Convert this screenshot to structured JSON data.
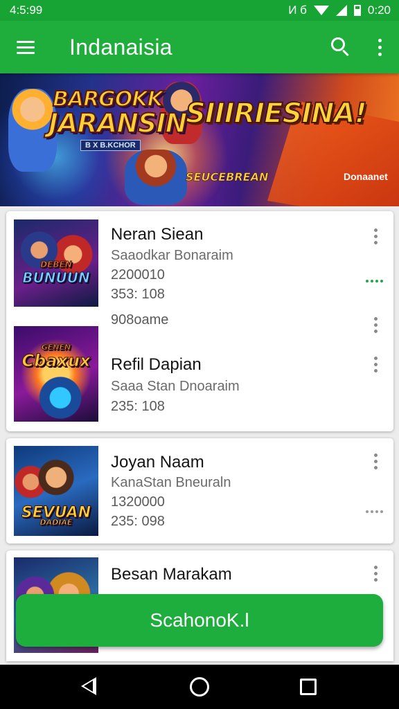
{
  "status_bar": {
    "time": "4:5:99",
    "status_icons": "И б",
    "clock": "0:20"
  },
  "app_bar": {
    "title": "Indanaisia",
    "menu_icon": "hamburger-icon",
    "search_icon": "search-icon",
    "overflow_icon": "vertical-dots-icon"
  },
  "banner": {
    "logo_line1": "BARGOKK",
    "logo_line2": "JARANSIN",
    "logo_sub": "B X B.KCHOR",
    "headline": "SIIIRIESINA!",
    "tagline": "SEUCEBREAN",
    "corner_label": "Donaanet"
  },
  "games": [
    {
      "title": "Neran Siean",
      "subtitle": "Saaodkar Bonaraim",
      "line1": "2200010",
      "line2": "353: 108",
      "thumb_text": [
        "DEBEN",
        "BUNUUN"
      ]
    },
    {
      "title": "Refil Dapian",
      "subtitle": "Saaa Stan Dnoaraim",
      "line1": "908oame",
      "line2": "235: 108",
      "thumb_text": [
        "GENEN",
        "Cbaxux"
      ]
    },
    {
      "title": "Joyan Naam",
      "subtitle": "KanaStan Bneuraln",
      "line1": "1320000",
      "line2": "235: 098",
      "thumb_text": [
        "SEVUAN",
        "DADIAE"
      ]
    },
    {
      "title": "Besan Marakam",
      "subtitle": ""
    }
  ],
  "action_button": {
    "label": "ScahonoK.l"
  },
  "nav_bar": {
    "back_icon": "back-icon",
    "home_icon": "home-icon",
    "recents_icon": "recents-icon"
  },
  "colors": {
    "primary": "#1fae3c",
    "status_bar": "#17a434",
    "accent_dots": "#23a845"
  }
}
